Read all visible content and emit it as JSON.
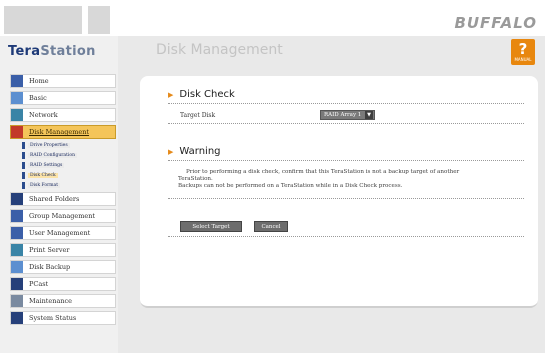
{
  "brand": {
    "vendor": "BUFFALO",
    "product_bold": "Tera",
    "product_light": "Station"
  },
  "help": {
    "symbol": "?",
    "label": "MANUAL"
  },
  "page": {
    "title": "Disk Management"
  },
  "sidebar": {
    "items": [
      {
        "label": "Home",
        "icon": "home-icon",
        "color": "blue"
      },
      {
        "label": "Basic",
        "icon": "basic-settings-icon",
        "color": "lblue"
      },
      {
        "label": "Network",
        "icon": "network-icon",
        "color": "teal"
      },
      {
        "label": "Disk Management",
        "icon": "disk-icon",
        "color": "red"
      },
      {
        "label": "Shared Folders",
        "icon": "folder-icon",
        "color": "navy"
      },
      {
        "label": "Group Management",
        "icon": "group-icon",
        "color": "blue"
      },
      {
        "label": "User Management",
        "icon": "user-icon",
        "color": "blue"
      },
      {
        "label": "Print Server",
        "icon": "printer-icon",
        "color": "teal"
      },
      {
        "label": "Disk Backup",
        "icon": "backup-icon",
        "color": "lblue"
      },
      {
        "label": "PCast",
        "icon": "pcast-icon",
        "color": "navy"
      },
      {
        "label": "Maintenance",
        "icon": "maintenance-icon",
        "color": "grey"
      },
      {
        "label": "System Status",
        "icon": "status-icon",
        "color": "navy"
      }
    ],
    "sub_items": [
      {
        "label": "Drive Properties"
      },
      {
        "label": "RAID Configuration"
      },
      {
        "label": "RAID Settings"
      },
      {
        "label": "Disk Check"
      },
      {
        "label": "Disk Format"
      }
    ]
  },
  "disk_check": {
    "section_title": "Disk Check",
    "target_label": "Target Disk",
    "target_value": "RAID Array 1"
  },
  "warning": {
    "section_title": "Warning",
    "line1": "Prior to performing a disk check, confirm that this TeraStation is not a backup target of another",
    "line2": "TeraStation.",
    "line3": "Backups can not be performed on a TeraStation while in a Disk Check process."
  },
  "buttons": {
    "select_target": "Select Target",
    "cancel": "Cancel"
  },
  "colors": {
    "accent": "#e8870e",
    "active_nav": "#f4c55a",
    "brand_dark": "#1e3a78"
  }
}
